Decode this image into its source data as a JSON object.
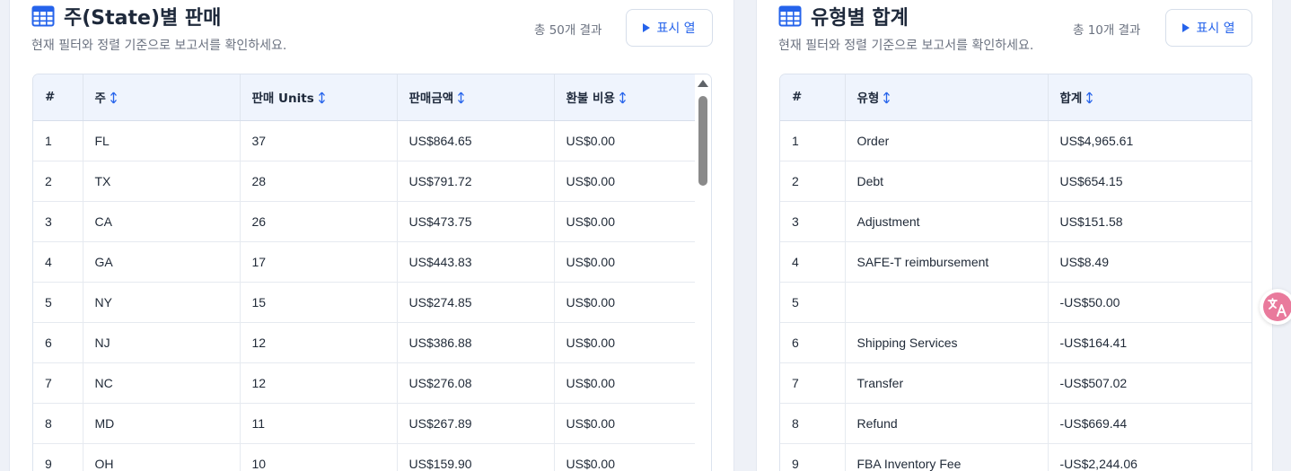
{
  "left_panel": {
    "title": "주(State)별 판매",
    "subtitle": "현재 필터와 정렬 기준으로 보고서를 확인하세요.",
    "total_text": "총 50개 결과",
    "columns_button": "표시 열",
    "headers": [
      "#",
      "주",
      "판매 Units",
      "판매금액",
      "환불 비용"
    ],
    "rows": [
      [
        "1",
        "FL",
        "37",
        "US$864.65",
        "US$0.00"
      ],
      [
        "2",
        "TX",
        "28",
        "US$791.72",
        "US$0.00"
      ],
      [
        "3",
        "CA",
        "26",
        "US$473.75",
        "US$0.00"
      ],
      [
        "4",
        "GA",
        "17",
        "US$443.83",
        "US$0.00"
      ],
      [
        "5",
        "NY",
        "15",
        "US$274.85",
        "US$0.00"
      ],
      [
        "6",
        "NJ",
        "12",
        "US$386.88",
        "US$0.00"
      ],
      [
        "7",
        "NC",
        "12",
        "US$276.08",
        "US$0.00"
      ],
      [
        "8",
        "MD",
        "11",
        "US$267.89",
        "US$0.00"
      ],
      [
        "9",
        "OH",
        "10",
        "US$159.90",
        "US$0.00"
      ]
    ]
  },
  "right_panel": {
    "title": "유형별 합계",
    "subtitle": "현재 필터와 정렬 기준으로 보고서를 확인하세요.",
    "total_text": "총 10개 결과",
    "columns_button": "표시 열",
    "headers": [
      "#",
      "유형",
      "합계"
    ],
    "rows": [
      [
        "1",
        "Order",
        "US$4,965.61"
      ],
      [
        "2",
        "Debt",
        "US$654.15"
      ],
      [
        "3",
        "Adjustment",
        "US$151.58"
      ],
      [
        "4",
        "SAFE-T reimbursement",
        "US$8.49"
      ],
      [
        "5",
        "",
        "-US$50.00"
      ],
      [
        "6",
        "Shipping Services",
        "-US$164.41"
      ],
      [
        "7",
        "Transfer",
        "-US$507.02"
      ],
      [
        "8",
        "Refund",
        "-US$669.44"
      ],
      [
        "9",
        "FBA Inventory Fee",
        "-US$2,244.06"
      ]
    ]
  },
  "colors": {
    "accent": "#2563eb",
    "header_bg": "#eff4fd",
    "translate_icon": "#e97a9c"
  },
  "icons": {
    "title": "table-grid-icon",
    "sort": "sort-updown-icon",
    "columns_button": "play-triangle-icon",
    "translate": "translate-icon"
  }
}
